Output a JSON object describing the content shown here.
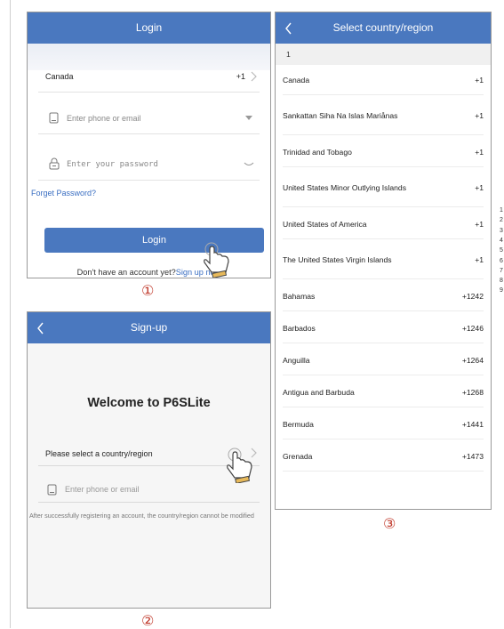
{
  "login": {
    "title": "Login",
    "country": "Canada",
    "country_code": "+1",
    "phone_placeholder": "Enter phone or email",
    "password_placeholder": "Enter your password",
    "forget_password": "Forget Password?",
    "login_button": "Login",
    "no_account_text": "Don't have an account yet?",
    "sign_up_link": "Sign up now"
  },
  "signup": {
    "title": "Sign-up",
    "welcome": "Welcome to P6SLite",
    "select_country": "Please select a country/region",
    "phone_placeholder": "Enter phone or email",
    "note": "After successfully registering an account, the country/region cannot be modified"
  },
  "country_select": {
    "title": "Select country/region",
    "section_header": "1",
    "countries": [
      {
        "name": "Canada",
        "code": "+1"
      },
      {
        "name": "Sankattan Siha Na Islas Mariånas",
        "code": "+1"
      },
      {
        "name": "Trinidad and Tobago",
        "code": "+1"
      },
      {
        "name": "United States Minor Outlying Islands",
        "code": "+1"
      },
      {
        "name": "United States of America",
        "code": "+1"
      },
      {
        "name": "The United States Virgin Islands",
        "code": "+1"
      },
      {
        "name": "Bahamas",
        "code": "+1242"
      },
      {
        "name": "Barbados",
        "code": "+1246"
      },
      {
        "name": "Anguilla",
        "code": "+1264"
      },
      {
        "name": "Antigua and Barbuda",
        "code": "+1268"
      },
      {
        "name": "Bermuda",
        "code": "+1441"
      },
      {
        "name": "Grenada",
        "code": "+1473"
      }
    ],
    "index": [
      "1",
      "2",
      "3",
      "4",
      "5",
      "6",
      "7",
      "8",
      "9"
    ]
  },
  "step_labels": [
    "①",
    "②",
    "③"
  ],
  "icons": {
    "back": "chevron-left-icon",
    "chevron": "chevron-right-icon",
    "phone": "phone-icon",
    "lock": "lock-icon",
    "dropdown": "dropdown-triangle-icon",
    "eye": "eye-closed-icon",
    "hand": "hand-pointer-icon"
  },
  "colors": {
    "accent": "#4a78bf",
    "link": "#3b6fc2",
    "step_label": "#c0392b"
  }
}
